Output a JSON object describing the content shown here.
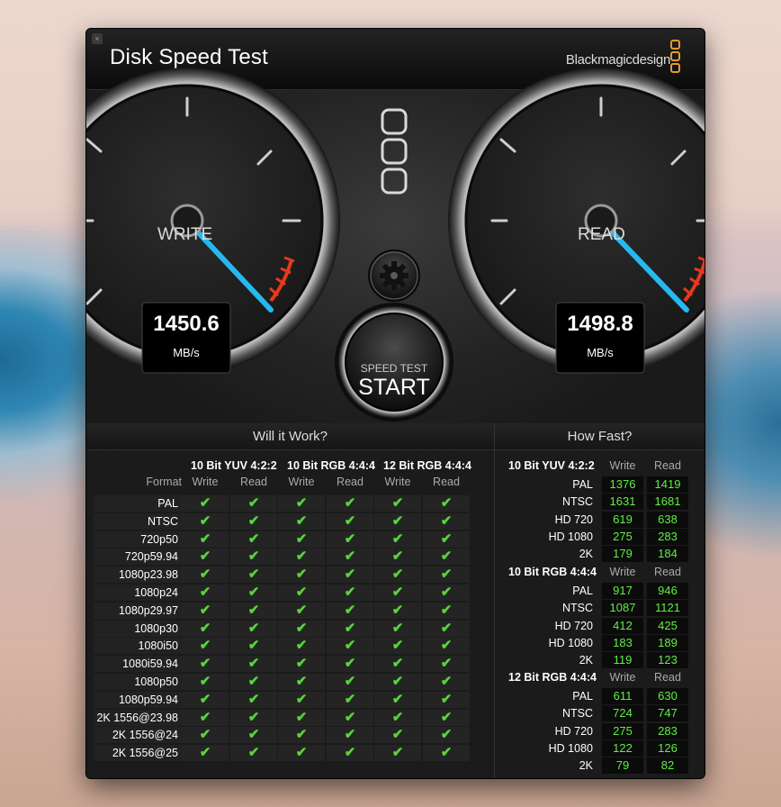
{
  "window": {
    "title": "Disk Speed Test",
    "brand": "Blackmagicdesign",
    "close_glyph": "×"
  },
  "gauges": {
    "write": {
      "label": "WRITE",
      "value": "1450.6",
      "unit": "MB/s"
    },
    "read": {
      "label": "READ",
      "value": "1498.8",
      "unit": "MB/s"
    }
  },
  "start_button": {
    "top": "SPEED TEST",
    "main": "START"
  },
  "settings_icon": "gear-icon",
  "will_it_work": {
    "title": "Will it Work?",
    "format_label": "Format",
    "groups": [
      "10 Bit YUV 4:2:2",
      "10 Bit RGB 4:4:4",
      "12 Bit RGB 4:4:4"
    ],
    "sub_labels": [
      "Write",
      "Read"
    ],
    "formats": [
      "PAL",
      "NTSC",
      "720p50",
      "720p59.94",
      "1080p23.98",
      "1080p24",
      "1080p29.97",
      "1080p30",
      "1080i50",
      "1080i59.94",
      "1080p50",
      "1080p59.94",
      "2K 1556@23.98",
      "2K 1556@24",
      "2K 1556@25"
    ],
    "check_glyph": "✔"
  },
  "how_fast": {
    "title": "How Fast?",
    "sub_labels": [
      "Write",
      "Read"
    ],
    "sections": [
      {
        "name": "10 Bit YUV 4:2:2",
        "rows": [
          {
            "label": "PAL",
            "write": "1376",
            "read": "1419"
          },
          {
            "label": "NTSC",
            "write": "1631",
            "read": "1681"
          },
          {
            "label": "HD 720",
            "write": "619",
            "read": "638"
          },
          {
            "label": "HD 1080",
            "write": "275",
            "read": "283"
          },
          {
            "label": "2K",
            "write": "179",
            "read": "184"
          }
        ]
      },
      {
        "name": "10 Bit RGB 4:4:4",
        "rows": [
          {
            "label": "PAL",
            "write": "917",
            "read": "946"
          },
          {
            "label": "NTSC",
            "write": "1087",
            "read": "1121"
          },
          {
            "label": "HD 720",
            "write": "412",
            "read": "425"
          },
          {
            "label": "HD 1080",
            "write": "183",
            "read": "189"
          },
          {
            "label": "2K",
            "write": "119",
            "read": "123"
          }
        ]
      },
      {
        "name": "12 Bit RGB 4:4:4",
        "rows": [
          {
            "label": "PAL",
            "write": "611",
            "read": "630"
          },
          {
            "label": "NTSC",
            "write": "724",
            "read": "747"
          },
          {
            "label": "HD 720",
            "write": "275",
            "read": "283"
          },
          {
            "label": "HD 1080",
            "write": "122",
            "read": "126"
          },
          {
            "label": "2K",
            "write": "79",
            "read": "82"
          }
        ]
      }
    ]
  },
  "colors": {
    "accent_needle": "#27b8f0",
    "redline": "#e8381b",
    "value_green": "#5ef040",
    "brand_orange": "#e39a2f"
  }
}
